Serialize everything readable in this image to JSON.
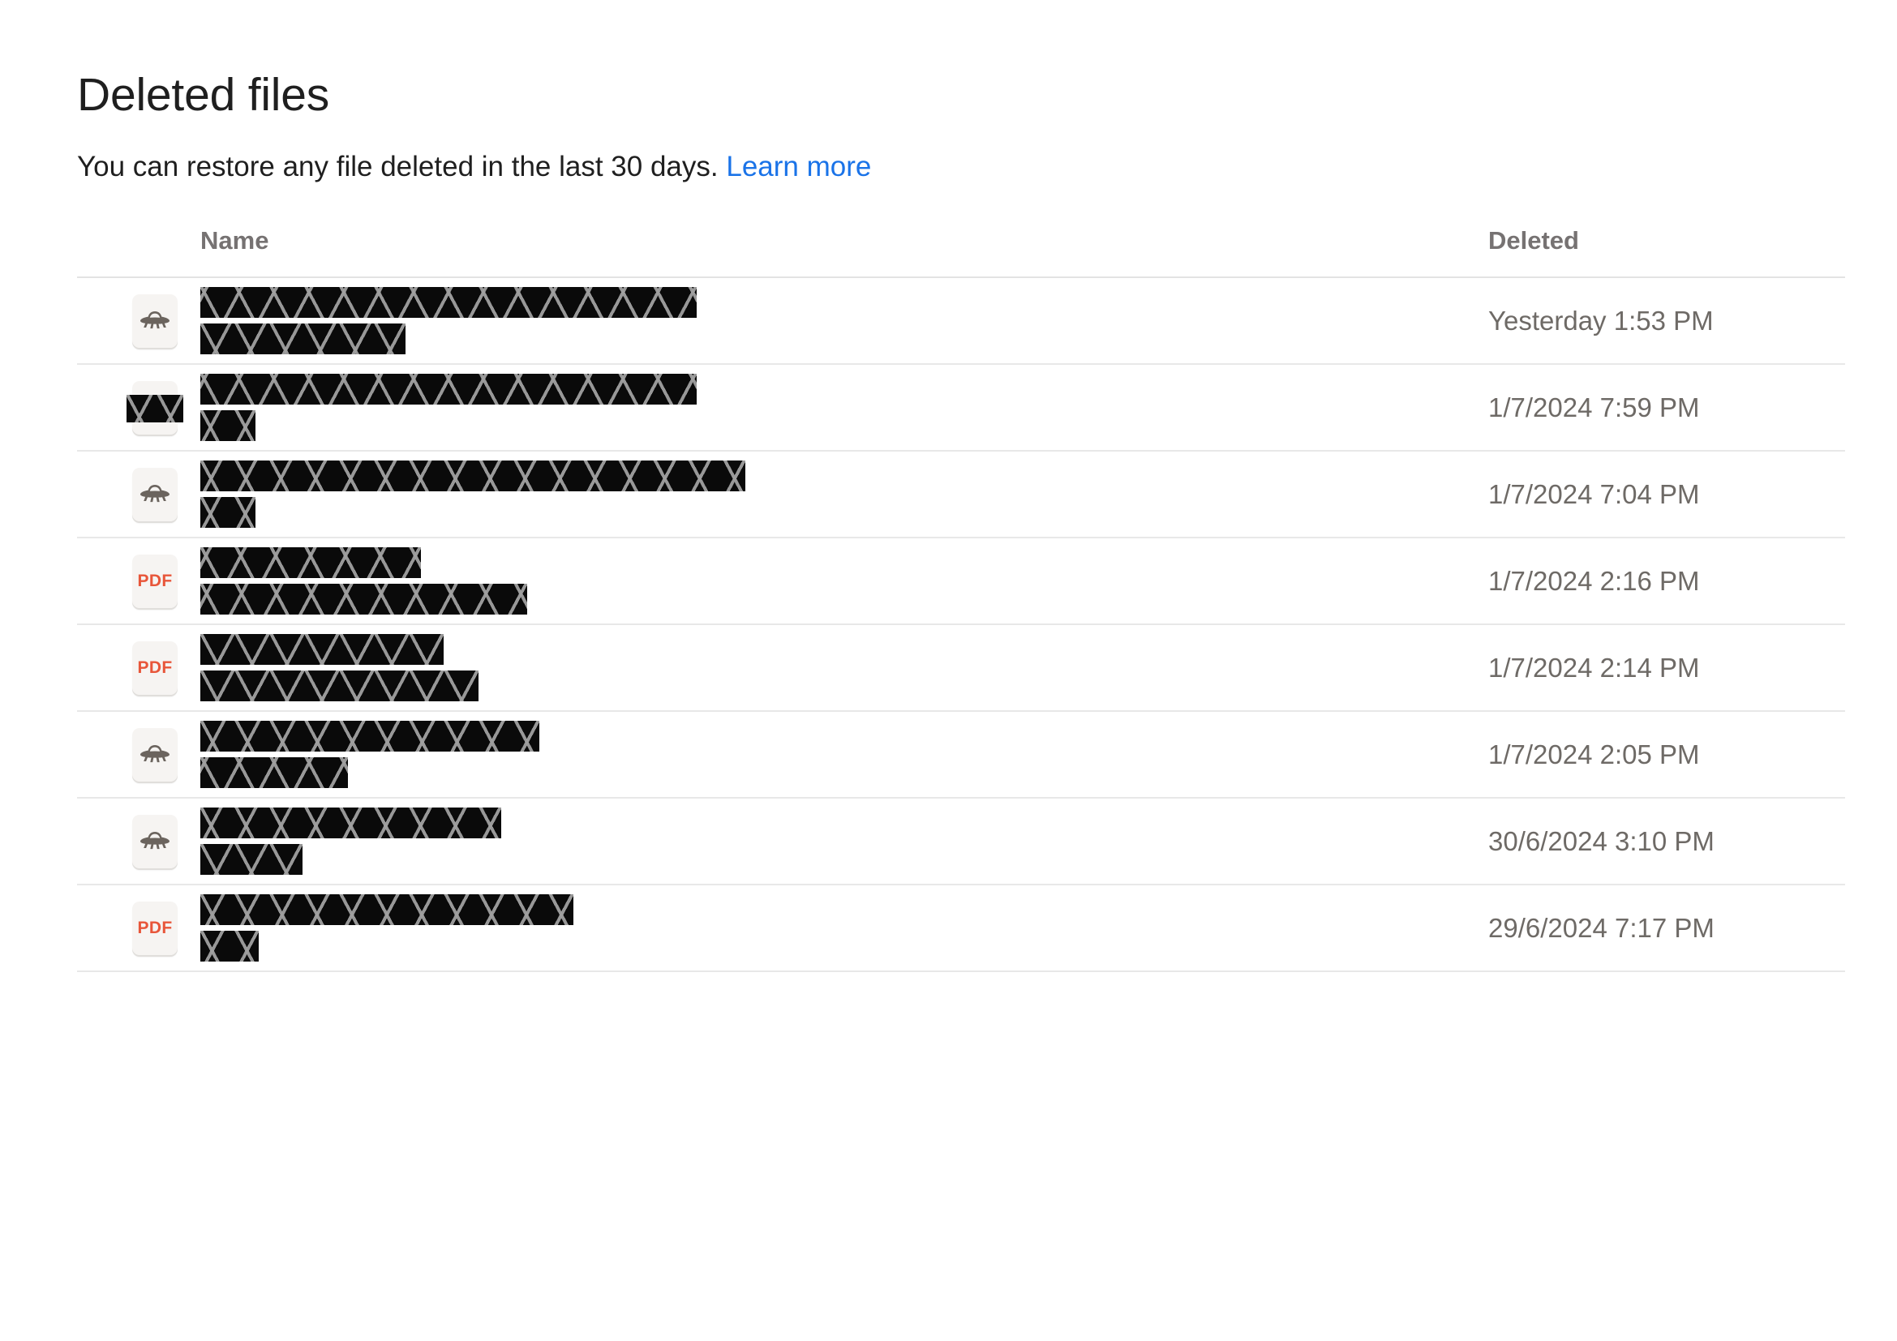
{
  "header": {
    "title": "Deleted files",
    "subtitle_text": "You can restore any file deleted in the last 30 days.",
    "learn_more_label": "Learn more",
    "learn_more_color": "#1a73e8"
  },
  "table": {
    "columns": {
      "name": "Name",
      "deleted": "Deleted"
    },
    "rows": [
      {
        "icon": "car-file-icon",
        "icon_type": "car",
        "icon_redacted": false,
        "name_redacted": true,
        "name_bar_widths": [
          612,
          253
        ],
        "deleted": "Yesterday 1:53 PM"
      },
      {
        "icon": "car-file-icon",
        "icon_type": "car",
        "icon_redacted": true,
        "name_redacted": true,
        "name_bar_widths": [
          612,
          68
        ],
        "deleted": "1/7/2024 7:59 PM"
      },
      {
        "icon": "car-file-icon",
        "icon_type": "car",
        "icon_redacted": false,
        "name_redacted": true,
        "name_bar_widths": [
          672,
          68
        ],
        "deleted": "1/7/2024 7:04 PM"
      },
      {
        "icon": "pdf-file-icon",
        "icon_type": "pdf",
        "icon_label": "PDF",
        "icon_redacted": false,
        "name_redacted": true,
        "name_bar_widths": [
          272,
          403
        ],
        "deleted": "1/7/2024 2:16 PM"
      },
      {
        "icon": "pdf-file-icon",
        "icon_type": "pdf",
        "icon_label": "PDF",
        "icon_redacted": false,
        "name_redacted": true,
        "name_bar_widths": [
          300,
          343
        ],
        "deleted": "1/7/2024 2:14 PM"
      },
      {
        "icon": "car-file-icon",
        "icon_type": "car",
        "icon_redacted": false,
        "name_redacted": true,
        "name_bar_widths": [
          418,
          182
        ],
        "deleted": "1/7/2024 2:05 PM"
      },
      {
        "icon": "car-file-icon",
        "icon_type": "car",
        "icon_redacted": false,
        "name_redacted": true,
        "name_bar_widths": [
          371,
          126
        ],
        "deleted": "30/6/2024 3:10 PM"
      },
      {
        "icon": "pdf-file-icon",
        "icon_type": "pdf",
        "icon_label": "PDF",
        "icon_redacted": false,
        "name_redacted": true,
        "name_bar_widths": [
          460,
          72
        ],
        "deleted": "29/6/2024 7:17 PM"
      }
    ]
  },
  "colors": {
    "page_background": "#ffffff",
    "title_text": "#1f1f1f",
    "header_text": "#767272",
    "timestamp_text": "#6e6a66",
    "link": "#1a73e8",
    "divider": "#e8e8e8",
    "icon_tile": "#f6f4f2",
    "pdf_accent": "#e8563a",
    "car_glyph": "#6b645e",
    "redaction": "#0a0a0a"
  }
}
